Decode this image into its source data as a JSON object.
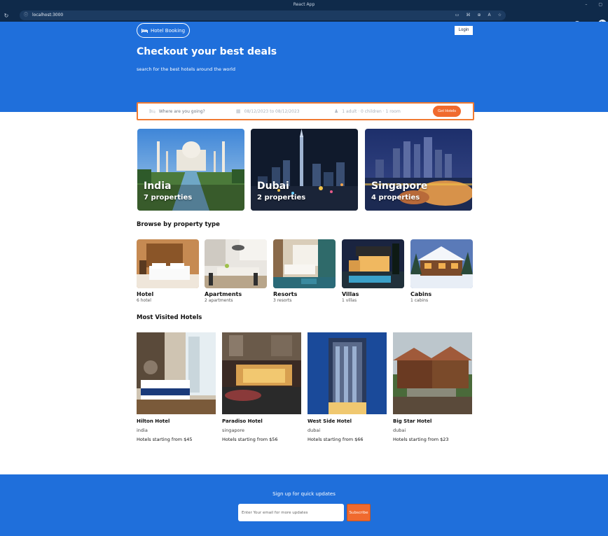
{
  "browser": {
    "window_title": "React App",
    "url": "localhost:3000"
  },
  "header": {
    "logo_text": "Hotel Booking",
    "login_label": "Login",
    "title": "Checkout your best deals",
    "subtitle": "search for the best hotels around the world"
  },
  "search": {
    "destination_placeholder": "Where are you going?",
    "date_range": "08/12/2023 to 08/12/2023",
    "guests": "1 adult · 0 children · 1 room",
    "button_label": "Get Hotels"
  },
  "featured": [
    {
      "city": "India",
      "properties": "7 properties"
    },
    {
      "city": "Dubai",
      "properties": "2 properties"
    },
    {
      "city": "Singapore",
      "properties": "4 properties"
    }
  ],
  "property_types": {
    "title": "Browse by property type",
    "items": [
      {
        "name": "Hotel",
        "count": "6 hotel"
      },
      {
        "name": "Apartments",
        "count": "2 apartments"
      },
      {
        "name": "Resorts",
        "count": "3 resorts"
      },
      {
        "name": "Villas",
        "count": "1 villas"
      },
      {
        "name": "Cabins",
        "count": "1 cabins"
      }
    ]
  },
  "most_visited": {
    "title": "Most Visited Hotels",
    "items": [
      {
        "name": "Hilton Hotel",
        "city": "india",
        "price": "Hotels starting from $45"
      },
      {
        "name": "Paradiso Hotel",
        "city": "singapore",
        "price": "Hotels starting from $56"
      },
      {
        "name": "West Side Hotel",
        "city": "dubai",
        "price": "Hotels starting from $66"
      },
      {
        "name": "Big Star Hotel",
        "city": "dubai",
        "price": "Hotels starting from $23"
      }
    ]
  },
  "footer": {
    "title": "Sign up for quick updates",
    "email_placeholder": "Enter Your email for more updates",
    "subscribe_label": "Subscribe"
  },
  "colors": {
    "primary": "#1f6fdb",
    "accent": "#f06a2e"
  }
}
